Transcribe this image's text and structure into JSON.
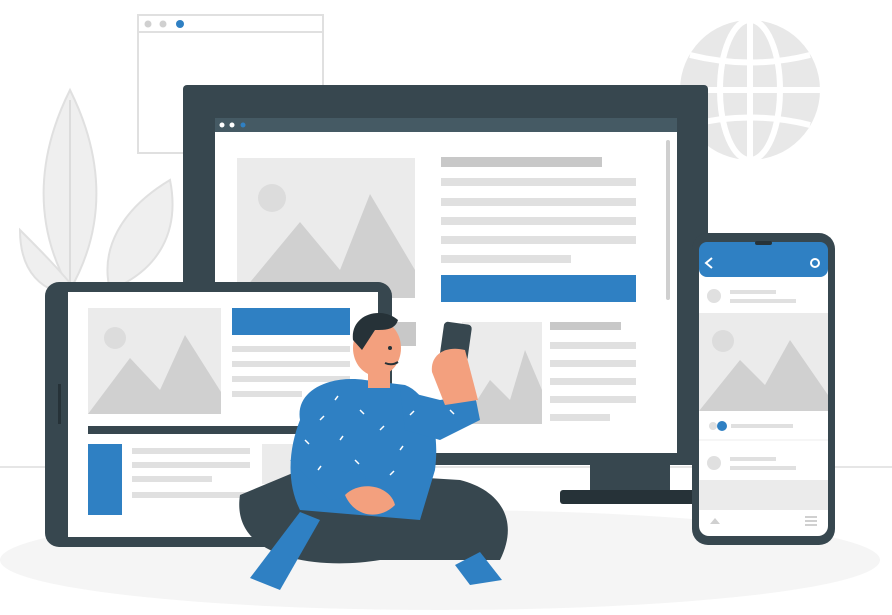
{
  "illustration": {
    "subject": "responsive-design",
    "palette": {
      "accent": "#2f80c3",
      "dark": "#37474f",
      "light_gray": "#ebebeb",
      "mid_gray": "#d0d0d0",
      "placeholder": "#e0e0e0",
      "mountain": "#c4c4c4",
      "skin": "#f3a07e",
      "hair": "#263238",
      "pants": "#37474f",
      "shoe": "#2f80c3"
    },
    "icons": [
      "globe-icon",
      "leaf-icon",
      "back-arrow-icon",
      "settings-icon",
      "avatar-icon",
      "home-icon",
      "menu-icon",
      "image-icon"
    ]
  }
}
